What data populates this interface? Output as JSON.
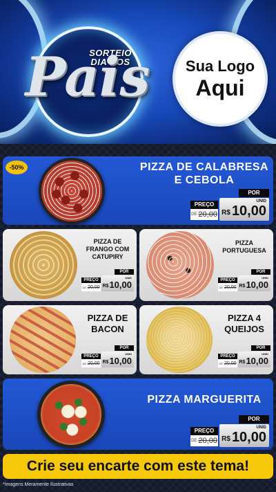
{
  "header": {
    "campaign_top": "SORTEIO\nDIA DOS",
    "campaign_main": "Pais",
    "logo_line1": "Sua Logo",
    "logo_line2": "Aqui"
  },
  "currency": "R$",
  "unit_label": "UNID",
  "preco_label": "PREÇO",
  "de_label": "DE",
  "por_label": "POR",
  "products": [
    {
      "name": "PIZZA DE CALABRESA E CEBOLA",
      "badge": "-50%",
      "old_price": "20,00",
      "price": "10,00"
    },
    {
      "name": "PIZZA DE FRANGO COM CATUPIRY",
      "old_price": "20,00",
      "price": "10,00"
    },
    {
      "name": "PIZZA PORTUGUESA",
      "old_price": "20,00",
      "price": "10,00"
    },
    {
      "name": "PIZZA DE BACON",
      "old_price": "20,00",
      "price": "10,00"
    },
    {
      "name": "PIZZA 4 QUEIJOS",
      "old_price": "20,00",
      "price": "10,00"
    },
    {
      "name": "PIZZA MARGUERITA",
      "old_price": "20,00",
      "price": "10,00"
    }
  ],
  "cta": "Crie seu encarte com este tema!",
  "disclaimer": "*Imagens Meramente Ilustrativas",
  "colors": {
    "blue_card": "#2358d6",
    "cta_yellow": "#f6c80a",
    "tag_black": "#0b0b0b"
  }
}
